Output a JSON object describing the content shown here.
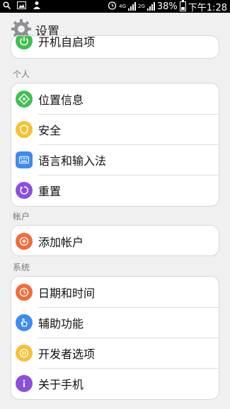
{
  "status_bar": {
    "network_4g": "4G",
    "network_2g": "2G",
    "battery": "38%",
    "time": "下午1:28"
  },
  "header": {
    "title": "设置"
  },
  "sections": [
    {
      "title": "",
      "items": [
        {
          "label": "开机自启项",
          "icon": "power-icon",
          "color": "#3ec14f"
        }
      ]
    },
    {
      "title": "个人",
      "items": [
        {
          "label": "位置信息",
          "icon": "location-icon",
          "color": "#3ec14f"
        },
        {
          "label": "安全",
          "icon": "shield-icon",
          "color": "#f6c234"
        },
        {
          "label": "语言和输入法",
          "icon": "keyboard-icon",
          "color": "#3d8cf1"
        },
        {
          "label": "重置",
          "icon": "reset-icon",
          "color": "#8b4fe0"
        }
      ]
    },
    {
      "title": "帐户",
      "items": [
        {
          "label": "添加帐户",
          "icon": "add-account-icon",
          "color": "#f26b3a"
        }
      ]
    },
    {
      "title": "系统",
      "items": [
        {
          "label": "日期和时间",
          "icon": "clock-icon",
          "color": "#f26b3a"
        },
        {
          "label": "辅助功能",
          "icon": "hand-icon",
          "color": "#3d8cf1"
        },
        {
          "label": "开发者选项",
          "icon": "developer-icon",
          "color": "#f6c234"
        },
        {
          "label": "关于手机",
          "icon": "info-icon",
          "color": "#8b4fe0"
        }
      ]
    }
  ]
}
